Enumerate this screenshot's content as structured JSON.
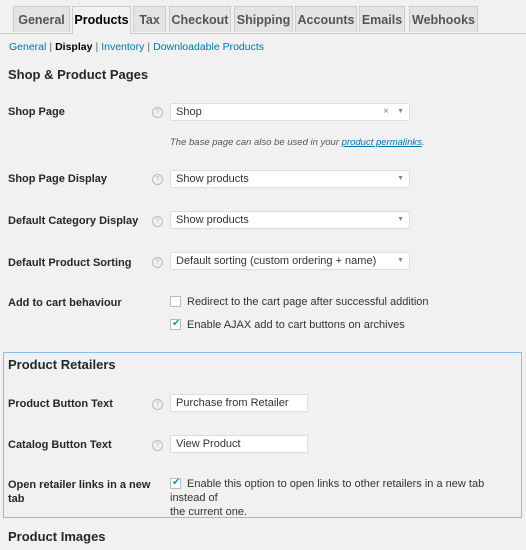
{
  "tabs": [
    {
      "label": "General",
      "active": false
    },
    {
      "label": "Products",
      "active": true
    },
    {
      "label": "Tax",
      "active": false
    },
    {
      "label": "Checkout",
      "active": false
    },
    {
      "label": "Shipping",
      "active": false
    },
    {
      "label": "Accounts",
      "active": false
    },
    {
      "label": "Emails",
      "active": false
    },
    {
      "label": "Webhooks",
      "active": false
    }
  ],
  "subnav": {
    "general": "General",
    "display": "Display",
    "inventory": "Inventory",
    "downloadable": "Downloadable Products",
    "separator": "|"
  },
  "shop_section": {
    "title": "Shop & Product Pages",
    "shop_page": {
      "label": "Shop Page",
      "value": "Shop",
      "clear_icon": "×",
      "desc_prefix": "The base page can also be used in your ",
      "desc_link": "product permalinks",
      "desc_suffix": "."
    },
    "shop_page_display": {
      "label": "Shop Page Display",
      "value": "Show products"
    },
    "default_category_display": {
      "label": "Default Category Display",
      "value": "Show products"
    },
    "default_product_sorting": {
      "label": "Default Product Sorting",
      "value": "Default sorting (custom ordering + name)"
    },
    "add_to_cart": {
      "label": "Add to cart behaviour",
      "options": [
        {
          "label": "Redirect to the cart page after successful addition",
          "checked": false
        },
        {
          "label": "Enable AJAX add to cart buttons on archives",
          "checked": true
        }
      ]
    }
  },
  "retailers_section": {
    "title": "Product Retailers",
    "product_button_text": {
      "label": "Product Button Text",
      "value": "Purchase from Retailer"
    },
    "catalog_button_text": {
      "label": "Catalog Button Text",
      "value": "View Product"
    },
    "open_new_tab": {
      "label_line1": "Open retailer links in a new",
      "label_line2": "tab",
      "checked": true,
      "text_line1": "Enable this option to open links to other retailers in a new tab instead of",
      "text_line2": "the current one."
    }
  },
  "images_section": {
    "title": "Product Images"
  },
  "icons": {
    "help": "?",
    "dropdown": "▼"
  },
  "colors": {
    "link": "#0073aa",
    "focus_border": "#8bbdf0",
    "check": "#1e8cbe"
  }
}
